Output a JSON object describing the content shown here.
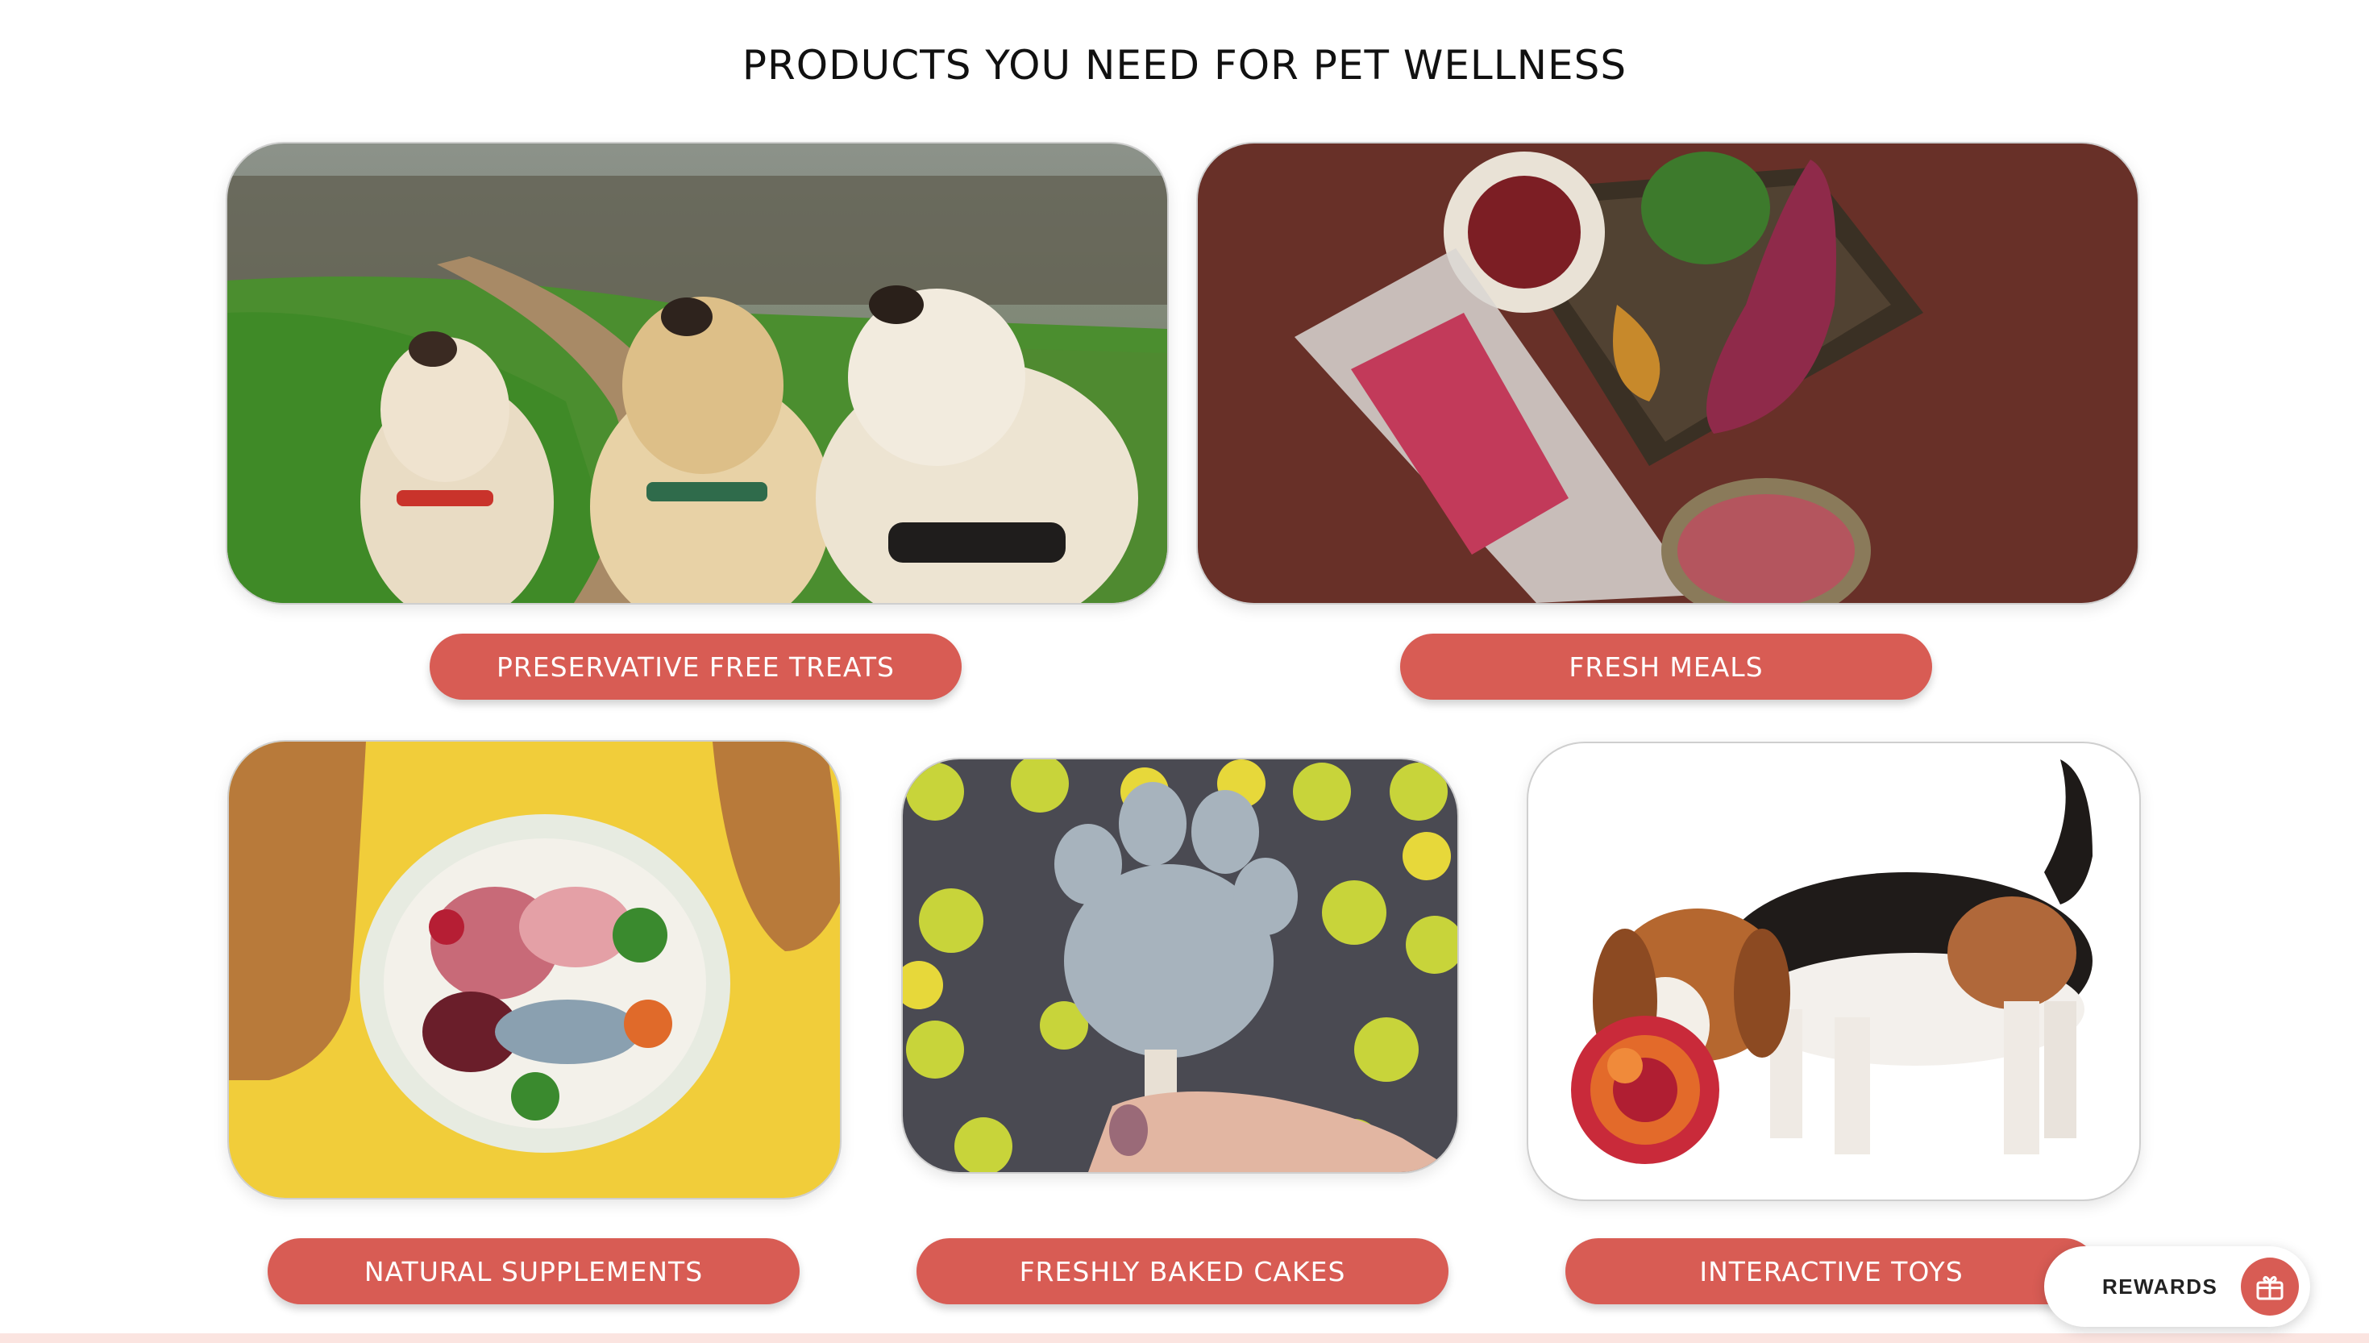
{
  "section": {
    "title": "PRODUCTS YOU NEED FOR PET WELLNESS"
  },
  "categories": [
    {
      "label": "PRESERVATIVE FREE TREATS",
      "image": "three dogs looking up on a trail"
    },
    {
      "label": "FRESH MEALS",
      "image": "fresh meal pack with sweet potato and raw meat"
    },
    {
      "label": "NATURAL SUPPLEMENTS",
      "image": "raw food bowl between dog paws on yellow"
    },
    {
      "label": "FRESHLY BAKED CAKES",
      "image": "paw shaped pupsicle held in hand"
    },
    {
      "label": "INTERACTIVE TOYS",
      "image": "beagle sniffing a snuffle ball"
    }
  ],
  "rewards": {
    "label": "REWARDS",
    "icon": "gift-icon"
  },
  "colors": {
    "button": "#d85c54",
    "button_text": "#ffffff",
    "footer_strip": "#fbe4e0"
  }
}
